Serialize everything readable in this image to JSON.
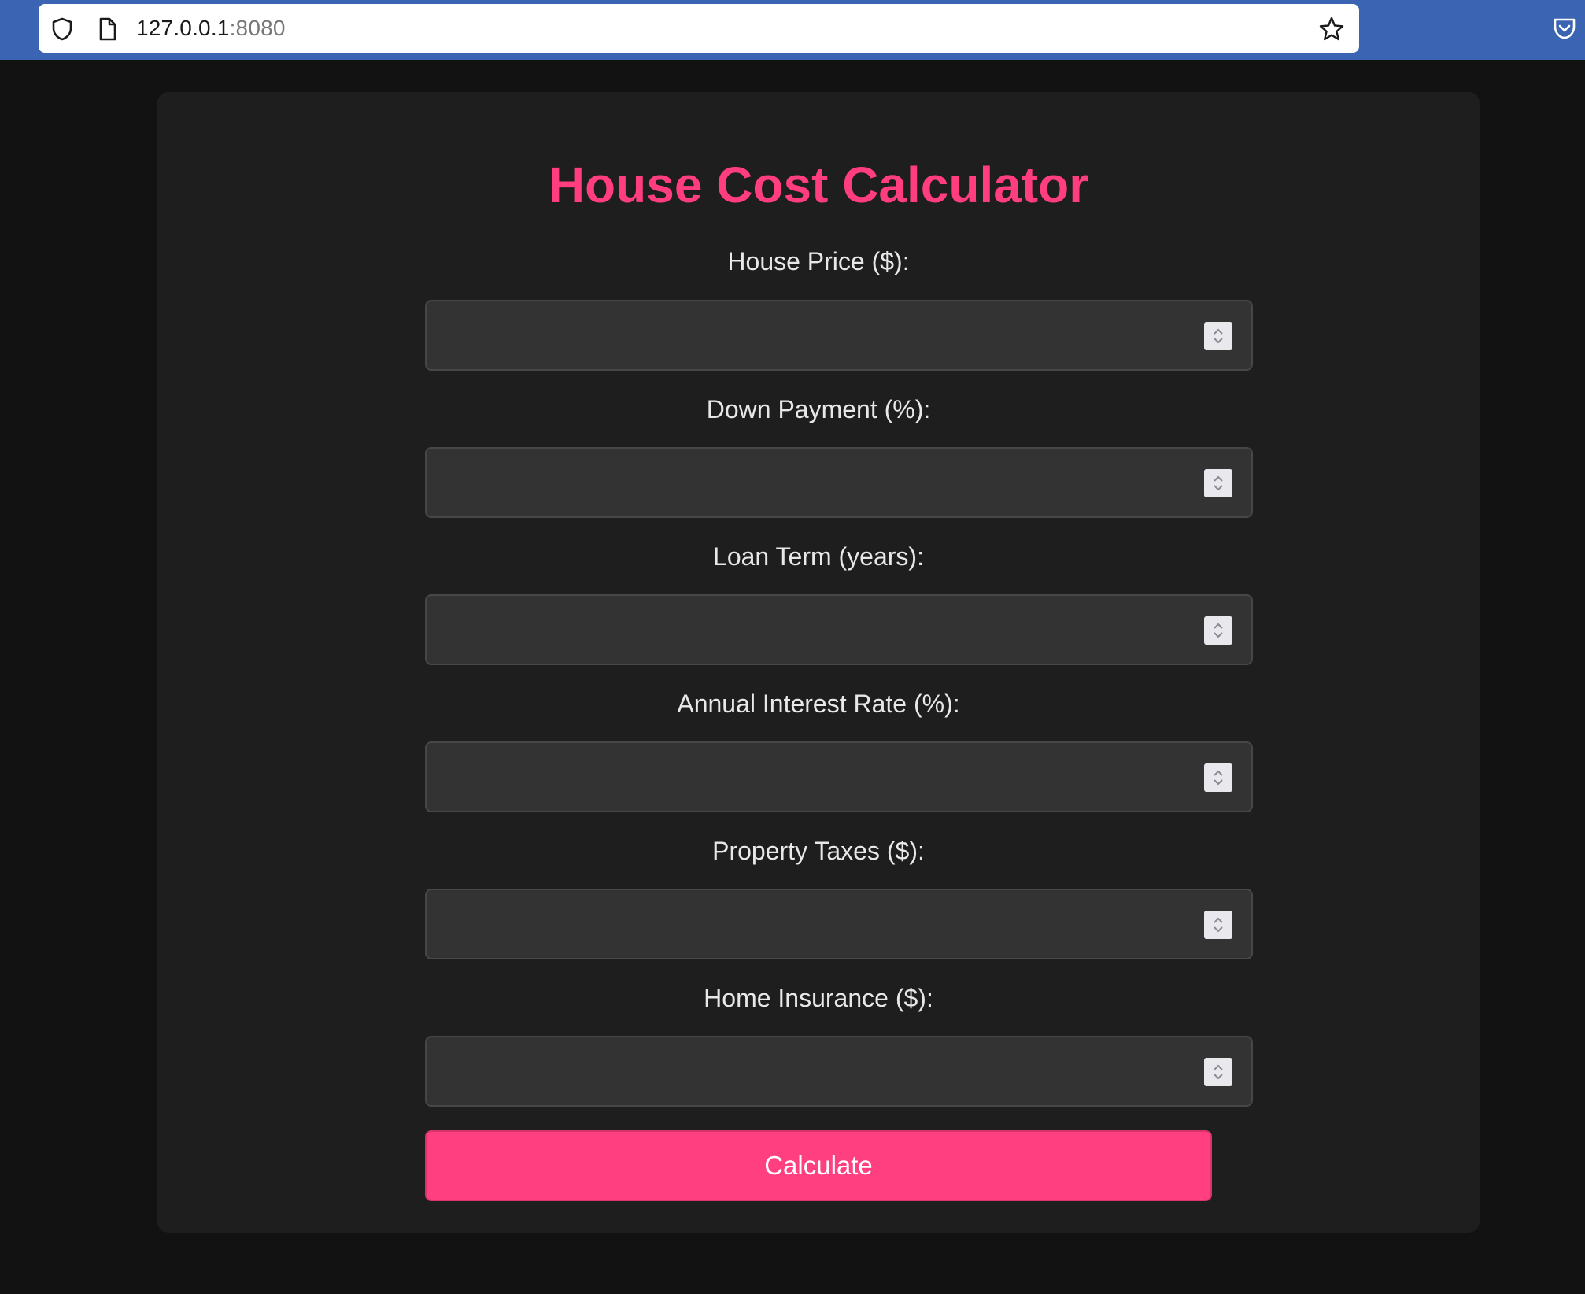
{
  "browser": {
    "url_host": "127.0.0.1",
    "url_port": ":8080",
    "icons": [
      "shield-icon",
      "page-icon",
      "star-icon",
      "pocket-icon"
    ]
  },
  "app": {
    "title": "House Cost Calculator",
    "accent_color": "#ff3d7f",
    "fields": [
      {
        "label": "House Price ($):",
        "value": ""
      },
      {
        "label": "Down Payment (%):",
        "value": ""
      },
      {
        "label": "Loan Term (years):",
        "value": ""
      },
      {
        "label": "Annual Interest Rate (%):",
        "value": ""
      },
      {
        "label": "Property Taxes ($):",
        "value": ""
      },
      {
        "label": "Home Insurance ($):",
        "value": ""
      }
    ],
    "button_label": "Calculate"
  }
}
